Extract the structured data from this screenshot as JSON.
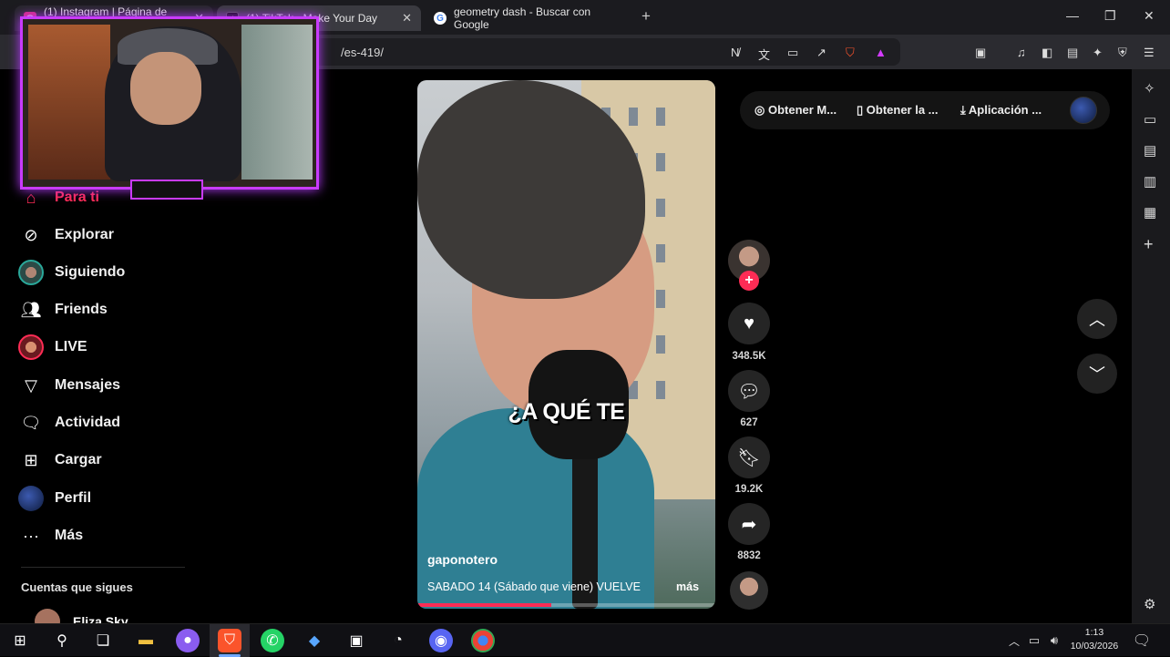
{
  "browser": {
    "tabs": [
      {
        "label": "(1) Instagram | Página de inicio",
        "favicon": "instagram-icon"
      },
      {
        "label": "(1) TikTok - Make Your Day",
        "favicon": "tiktok-icon"
      },
      {
        "label": "geometry dash - Buscar con Google",
        "favicon": "google-icon"
      }
    ],
    "url": "/es-419/",
    "colors": {
      "accent": "#fe2c55",
      "webcam_frame": "#c93bff"
    }
  },
  "nav": {
    "items": [
      {
        "label": "Para ti",
        "icon": "home-icon"
      },
      {
        "label": "Explorar",
        "icon": "compass-icon"
      },
      {
        "label": "Siguiendo",
        "icon": "following-avatar"
      },
      {
        "label": "Friends",
        "icon": "friends-icon"
      },
      {
        "label": "LIVE",
        "icon": "live-avatar"
      },
      {
        "label": "Mensajes",
        "icon": "send-icon"
      },
      {
        "label": "Actividad",
        "icon": "activity-icon"
      },
      {
        "label": "Cargar",
        "icon": "upload-icon"
      },
      {
        "label": "Perfil",
        "icon": "profile-avatar"
      },
      {
        "label": "Más",
        "icon": "more-icon"
      }
    ],
    "following_title": "Cuentas que sigues",
    "following": [
      {
        "name": "Eliza Sky"
      }
    ]
  },
  "top_actions": {
    "items": [
      {
        "label": "Obtener M...",
        "icon": "coin-icon"
      },
      {
        "label": "Obtener la ...",
        "icon": "phone-icon"
      },
      {
        "label": "Aplicación ...",
        "icon": "download-icon"
      }
    ]
  },
  "video": {
    "caption_overlay": "¿A QUÉ TE",
    "username": "gaponotero",
    "description": "SABADO 14 (Sábado que viene) VUELVE",
    "more_label": "más",
    "progress": 0.45
  },
  "actions": {
    "likes": "348.5K",
    "comments": "627",
    "saves": "19.2K",
    "shares": "8832"
  },
  "taskbar": {
    "time": "1:13",
    "date": "10/03/2026"
  }
}
